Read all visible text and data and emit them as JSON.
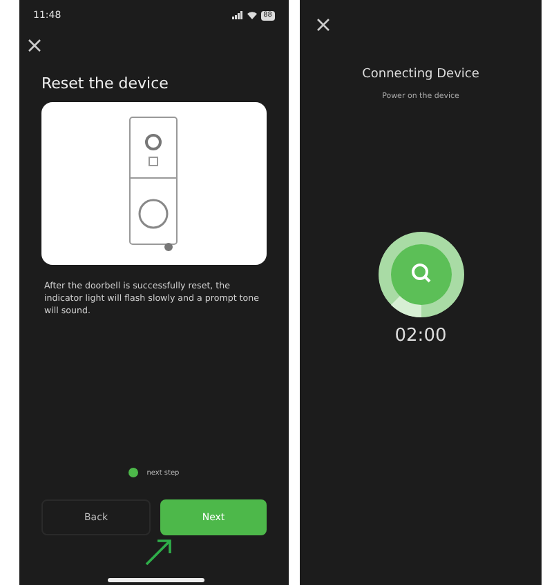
{
  "left_screen": {
    "status_bar": {
      "time": "11:48",
      "battery": "88"
    },
    "title": "Reset the device",
    "description": "After the doorbell is successfully reset, the indicator light will flash slowly and a prompt tone will sound.",
    "confirm": {
      "label": "next step",
      "checked": true
    },
    "buttons": [
      {
        "label": "Back",
        "kind": "secondary"
      },
      {
        "label": "Next",
        "kind": "primary"
      }
    ]
  },
  "right_screen": {
    "title": "Connecting Device",
    "subtitle": "Power on the device",
    "timer": "02:00"
  }
}
